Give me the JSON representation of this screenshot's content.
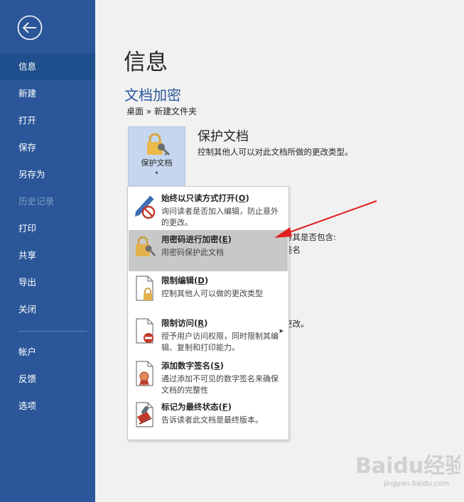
{
  "sidebar": {
    "items": [
      {
        "label": "信息",
        "state": "active"
      },
      {
        "label": "新建",
        "state": "normal"
      },
      {
        "label": "打开",
        "state": "normal"
      },
      {
        "label": "保存",
        "state": "normal"
      },
      {
        "label": "另存为",
        "state": "normal"
      },
      {
        "label": "历史记录",
        "state": "disabled"
      },
      {
        "label": "打印",
        "state": "normal"
      },
      {
        "label": "共享",
        "state": "normal"
      },
      {
        "label": "导出",
        "state": "normal"
      },
      {
        "label": "关闭",
        "state": "normal"
      },
      {
        "label": "帐户",
        "state": "normal"
      },
      {
        "label": "反馈",
        "state": "normal"
      },
      {
        "label": "选项",
        "state": "normal"
      }
    ],
    "back_icon": "back-arrow-circle-icon",
    "bg_color": "#2b579a"
  },
  "main": {
    "page_title": "信息",
    "doc_title": "文档加密",
    "doc_path": "桌面 » 新建文件夹",
    "protect": {
      "button_label": "保护文档",
      "caret": "▾",
      "heading": "保护文档",
      "description": "控制其他人可以对此文档所做的更改类型。"
    },
    "partial_text": {
      "line1": "意其是否包含:",
      "line2": "差名",
      "line3": "更改。"
    }
  },
  "menu": {
    "items": [
      {
        "title_pre": "始终以只读方式打开(",
        "key": "O",
        "title_post": ")",
        "desc": "询问读者是否加入编辑，防止意外的更改。",
        "icon": "pencil-no-icon"
      },
      {
        "title_pre": "用密码进行加密(",
        "key": "E",
        "title_post": ")",
        "desc": "用密码保护此文档",
        "icon": "lock-key-icon",
        "highlighted": true
      },
      {
        "title_pre": "限制编辑(",
        "key": "D",
        "title_post": ")",
        "desc": "控制其他人可以做的更改类型",
        "icon": "document-lock-icon"
      },
      {
        "title_pre": "限制访问(",
        "key": "R",
        "title_post": ")",
        "desc": "授予用户访问权限，同时限制其编辑、复制和打印能力。",
        "icon": "document-restrict-icon",
        "has_submenu": true
      },
      {
        "title_pre": "添加数字签名(",
        "key": "S",
        "title_post": ")",
        "desc": "通过添加不可见的数字签名来确保文档的完整性",
        "icon": "document-ribbon-icon"
      },
      {
        "title_pre": "标记为最终状态(",
        "key": "F",
        "title_post": ")",
        "desc": "告诉读者此文档是最终版本。",
        "icon": "document-stamp-icon"
      }
    ],
    "submenu_arrow": "▶"
  },
  "colors": {
    "accent": "#2b579a",
    "highlight": "#c8c8c8",
    "annotation": "#e02020"
  },
  "watermark": {
    "main": "Baidu经验",
    "sub": "jingyan.baidu.com"
  }
}
